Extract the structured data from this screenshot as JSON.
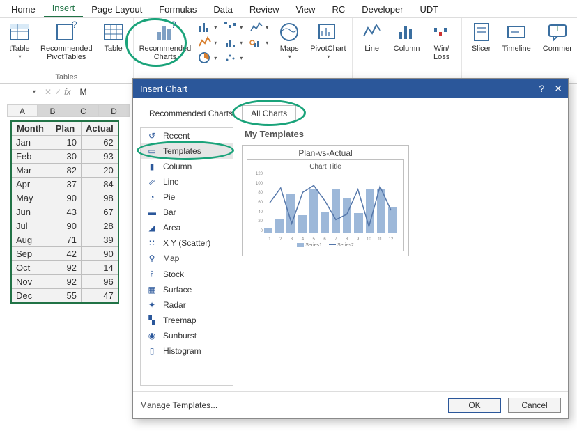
{
  "ribbon_tabs": [
    "Home",
    "Insert",
    "Page Layout",
    "Formulas",
    "Data",
    "Review",
    "View",
    "RC",
    "Developer",
    "UDT"
  ],
  "ribbon_active_tab": 1,
  "ribbon": {
    "group_tables": {
      "label": "Tables",
      "tTable": "tTable",
      "recPivot": "Recommended\nPivotTables",
      "table": "Table"
    },
    "group_charts": {
      "recCharts": "Recommended\nCharts",
      "maps": "Maps",
      "pivotChart": "PivotChart"
    },
    "group_spark": {
      "line": "Line",
      "column": "Column",
      "winloss": "Win/\nLoss"
    },
    "group_filters": {
      "slicer": "Slicer",
      "timeline": "Timeline"
    },
    "commer": "Commer"
  },
  "formula_bar": {
    "fx": "fx",
    "value": "M"
  },
  "columns": [
    "A",
    "B",
    "C",
    "D"
  ],
  "table_headers": [
    "Month",
    "Plan",
    "Actual"
  ],
  "table_rows": [
    [
      "Jan",
      10,
      62
    ],
    [
      "Feb",
      30,
      93
    ],
    [
      "Mar",
      82,
      20
    ],
    [
      "Apr",
      37,
      84
    ],
    [
      "May",
      90,
      98
    ],
    [
      "Jun",
      43,
      67
    ],
    [
      "Jul",
      90,
      28
    ],
    [
      "Aug",
      71,
      39
    ],
    [
      "Sep",
      42,
      90
    ],
    [
      "Oct",
      92,
      14
    ],
    [
      "Nov",
      92,
      96
    ],
    [
      "Dec",
      55,
      47
    ]
  ],
  "dialog": {
    "title": "Insert Chart",
    "tab_rec": "Recommended Charts",
    "tab_all": "All Charts",
    "pane_title": "My Templates",
    "template_name": "Plan-vs-Actual",
    "chart_title": "Chart Title",
    "legend1": "Series1",
    "legend2": "Series2",
    "manage": "Manage Templates...",
    "ok": "OK",
    "cancel": "Cancel",
    "help": "?",
    "close": "✕",
    "categories": [
      {
        "icon": "↺",
        "label": "Recent"
      },
      {
        "icon": "▭",
        "label": "Templates"
      },
      {
        "icon": "▮",
        "label": "Column"
      },
      {
        "icon": "⬀",
        "label": "Line"
      },
      {
        "icon": "◔",
        "label": "Pie"
      },
      {
        "icon": "▬",
        "label": "Bar"
      },
      {
        "icon": "◢",
        "label": "Area"
      },
      {
        "icon": "∷",
        "label": "X Y (Scatter)"
      },
      {
        "icon": "⚲",
        "label": "Map"
      },
      {
        "icon": "⫯",
        "label": "Stock"
      },
      {
        "icon": "▦",
        "label": "Surface"
      },
      {
        "icon": "✦",
        "label": "Radar"
      },
      {
        "icon": "▚",
        "label": "Treemap"
      },
      {
        "icon": "◉",
        "label": "Sunburst"
      },
      {
        "icon": "▯",
        "label": "Histogram"
      }
    ],
    "selected_category": 1
  },
  "chart_data": {
    "type": "bar",
    "title": "Chart Title",
    "xlabel": "",
    "ylabel": "",
    "x": [
      1,
      2,
      3,
      4,
      5,
      6,
      7,
      8,
      9,
      10,
      11,
      12
    ],
    "series": [
      {
        "name": "Series1",
        "type": "bar",
        "values": [
          10,
          30,
          82,
          37,
          90,
          43,
          90,
          71,
          42,
          92,
          92,
          55
        ]
      },
      {
        "name": "Series2",
        "type": "line",
        "values": [
          62,
          93,
          20,
          84,
          98,
          67,
          28,
          39,
          90,
          14,
          96,
          47
        ]
      }
    ],
    "ylim": [
      0,
      120
    ],
    "yticks": [
      0,
      20,
      40,
      60,
      80,
      100,
      120
    ]
  }
}
